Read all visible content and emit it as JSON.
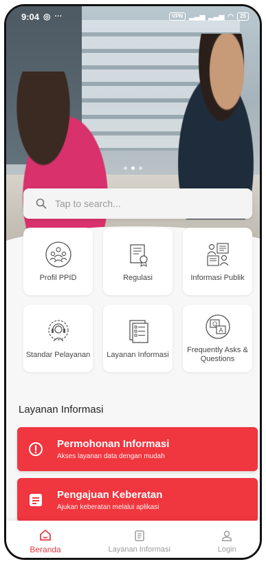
{
  "status_bar": {
    "time": "9:04",
    "icons_text": "VPN",
    "battery": "25"
  },
  "hero": {
    "slide_count": 3,
    "active_slide": 2
  },
  "search": {
    "placeholder": "Tap to search..."
  },
  "menu": [
    {
      "label": "Profil PPID",
      "icon": "people-group-icon"
    },
    {
      "label": "Regulasi",
      "icon": "document-certificate-icon"
    },
    {
      "label": "Informasi Publik",
      "icon": "public-info-icon"
    },
    {
      "label": "Standar Pelayanan",
      "icon": "customer-service-icon"
    },
    {
      "label": "Layanan Informasi",
      "icon": "document-list-icon"
    },
    {
      "label": "Frequently Asks & Questions",
      "icon": "faq-icon"
    }
  ],
  "section": {
    "title": "Layanan Informasi"
  },
  "cards": [
    {
      "title": "Permohonan Informasi",
      "subtitle": "Akses layanan data dengan mudah",
      "icon": "alert-circle-icon"
    },
    {
      "title": "Pengajuan Keberatan",
      "subtitle": "Ajukan keberatan melalui aplikasi",
      "icon": "note-icon"
    }
  ],
  "bottom_nav": [
    {
      "label": "Beranda",
      "icon": "home-icon",
      "active": true
    },
    {
      "label": "Layanan Informasi",
      "icon": "document-icon",
      "active": false
    },
    {
      "label": "Login",
      "icon": "user-icon",
      "active": false
    }
  ],
  "colors": {
    "primary": "#f0363f",
    "active_nav": "#e53942"
  }
}
